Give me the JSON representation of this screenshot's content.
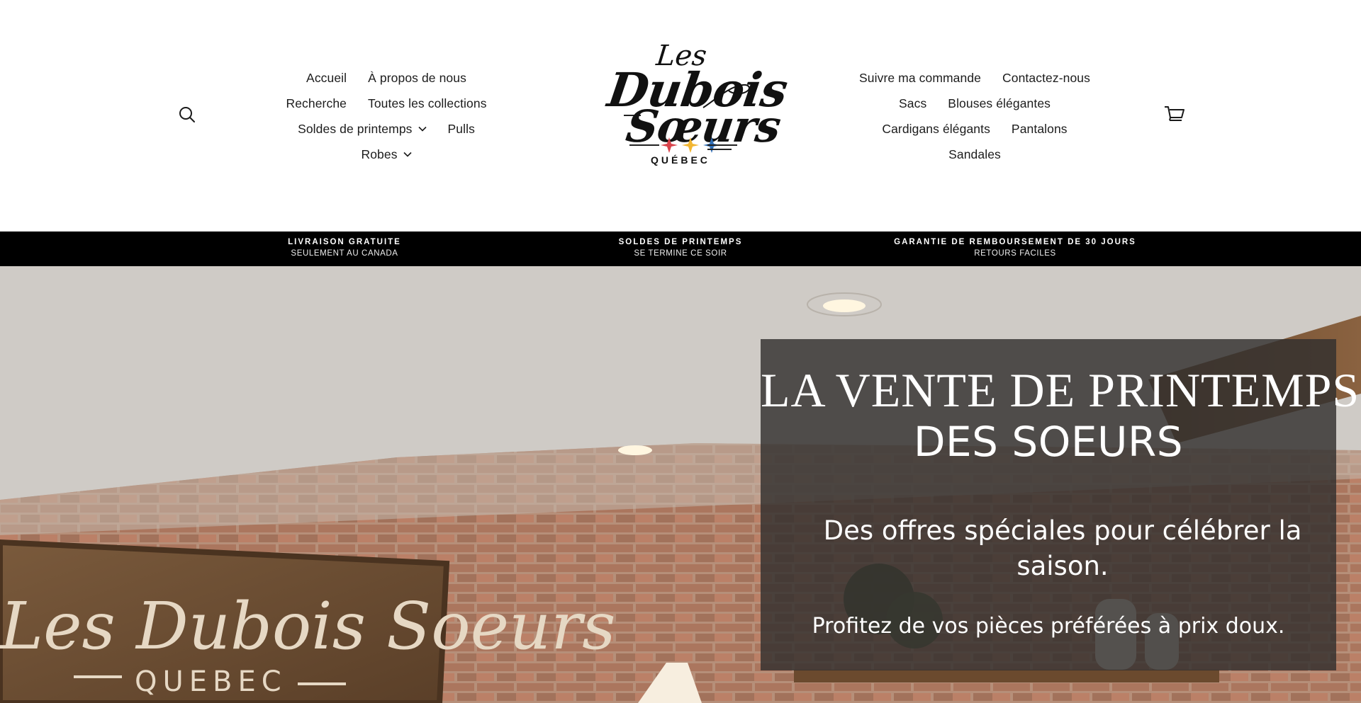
{
  "brand": {
    "logo_line1": "Les",
    "logo_line2": "Dubois",
    "logo_line3": "Sœurs",
    "logo_line4": "QUÉBEC"
  },
  "header": {
    "search_icon": "search-icon",
    "cart_icon": "cart-icon",
    "nav_left": [
      [
        "Accueil",
        "À propos de nous"
      ],
      [
        "Recherche",
        "Toutes les collections"
      ],
      [
        "Soldes de printemps",
        "Pulls"
      ],
      [
        "Robes"
      ]
    ],
    "nav_left_flat": {
      "accueil": "Accueil",
      "a_propos": "À propos de nous",
      "recherche": "Recherche",
      "toutes": "Toutes les collections",
      "soldes": "Soldes de printemps",
      "pulls": "Pulls",
      "robes": "Robes"
    },
    "nav_right": {
      "suivre": "Suivre ma commande",
      "contact": "Contactez-nous",
      "sacs": "Sacs",
      "blouses": "Blouses élégantes",
      "cardigans": "Cardigans élégants",
      "pantalons": "Pantalons",
      "sandales": "Sandales"
    }
  },
  "announcement": [
    {
      "title": "LIVRAISON GRATUITE",
      "sub": "SEULEMENT AU CANADA"
    },
    {
      "title": "SOLDES DE PRINTEMPS",
      "sub": "SE TERMINE CE SOIR"
    },
    {
      "title": "GARANTIE DE REMBOURSEMENT DE 30 JOURS",
      "sub": "RETOURS FACILES"
    }
  ],
  "hero": {
    "title_line1": "LA VENTE DE PRINTEMPS",
    "title_line2": "DES SOEURS",
    "subtitle": "Des offres spéciales pour célébrer la saison.",
    "subtitle2": "Profitez de vos pièces préférées à prix doux.",
    "sign_text": "Les Dubois Soeurs",
    "sign_sub": "QUEBEC"
  },
  "colors": {
    "announce_bg": "#000000",
    "overlay_bg": "rgba(50,48,46,0.82)",
    "star_red": "#d9434b",
    "star_yellow": "#f2b632",
    "star_blue": "#2f6fb8"
  }
}
